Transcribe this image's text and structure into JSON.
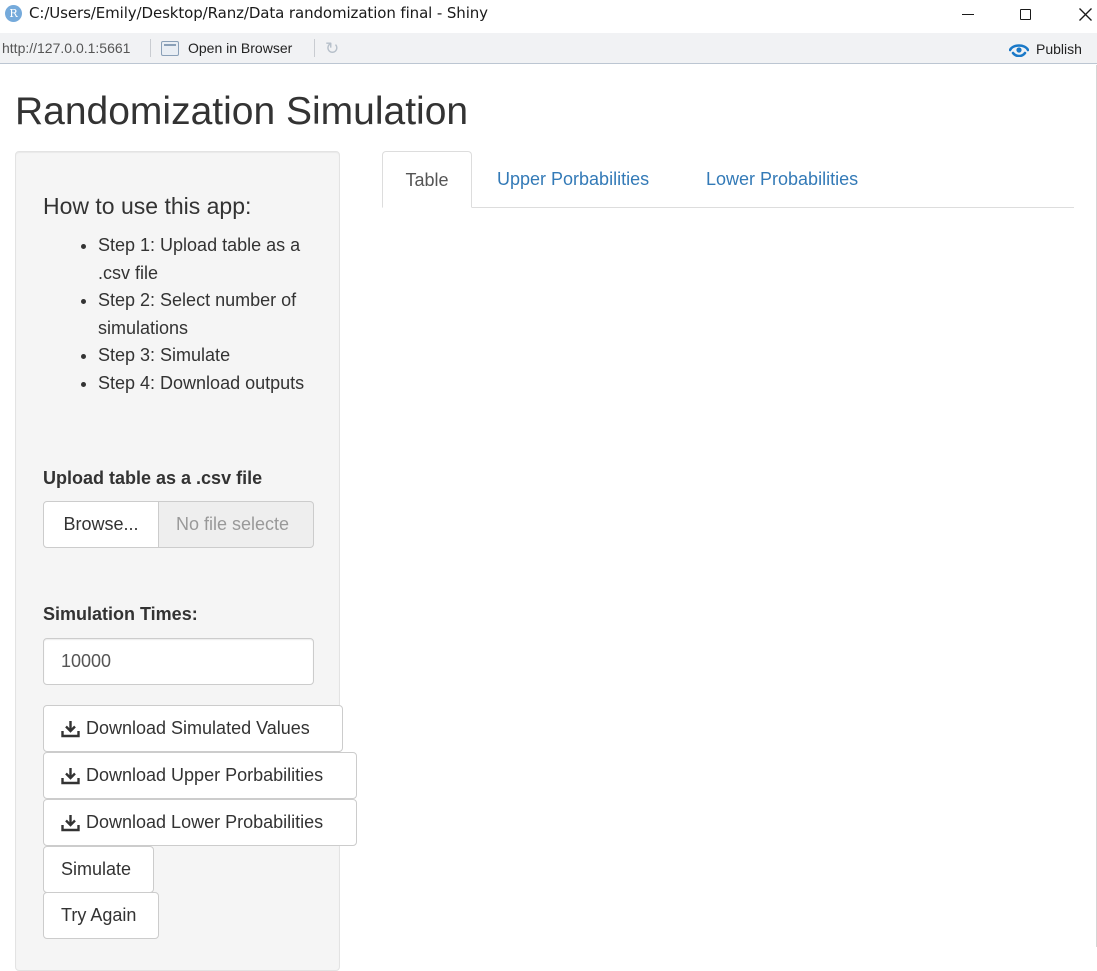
{
  "window": {
    "title": "C:/Users/Emily/Desktop/Ranz/Data randomization final - Shiny",
    "app_icon_letter": "R",
    "controls": [
      "minimize-icon",
      "maximize-icon",
      "close-icon"
    ]
  },
  "toolbar": {
    "url": "http://127.0.0.1:5661",
    "open_in_browser": "Open in Browser",
    "refresh_icon": "refresh-icon",
    "publish": "Publish"
  },
  "app": {
    "title": "Randomization Simulation"
  },
  "sidebar": {
    "howto_title": "How to use this app:",
    "steps": [
      "Step 1: Upload table as a .csv file",
      "Step 2: Select number of simulations",
      "Step 3: Simulate",
      "Step 4: Download outputs"
    ],
    "upload_label": "Upload table as a .csv file",
    "browse_label": "Browse...",
    "file_status": "No file selecte",
    "sim_label": "Simulation Times:",
    "sim_value": "10000",
    "buttons": {
      "download_sim": "Download Simulated Values",
      "download_upper": "Download Upper Porbabilities",
      "download_lower": "Download Lower Probabilities",
      "simulate": "Simulate",
      "try_again": "Try Again"
    }
  },
  "tabs": [
    {
      "label": "Table",
      "active": true
    },
    {
      "label": "Upper Porbabilities",
      "active": false
    },
    {
      "label": "Lower Probabilities",
      "active": false
    }
  ],
  "colors": {
    "link": "#337ab7",
    "well_background": "#f5f5f5",
    "rstudio_blue": "#75aadb",
    "publish_blue": "#1a79c8"
  }
}
